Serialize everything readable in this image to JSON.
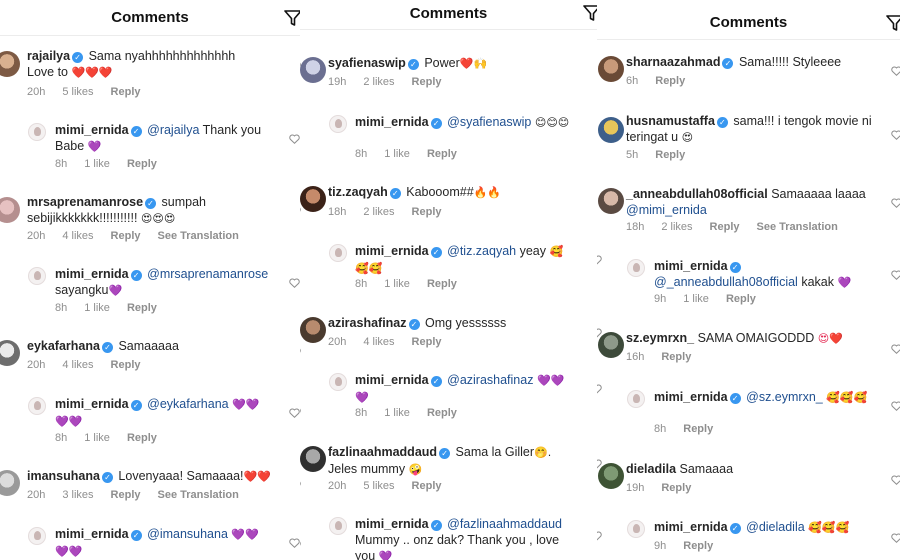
{
  "panels": [
    {
      "title": "Comments",
      "comments": [
        {
          "user": "rajailya",
          "verified": true,
          "text": "Sama nyahhhhhhhhhhhhh",
          "text2": "Love to",
          "emoji": "❤️❤️❤️",
          "time": "20h",
          "likes": "5 likes",
          "reply": "Reply",
          "translate": ""
        },
        {
          "user": "mimi_ernida",
          "verified": true,
          "mention": "@rajailya",
          "text": "Thank you",
          "text2": "Babe",
          "emoji": "💜",
          "time": "8h",
          "likes": "1 like",
          "reply": "Reply",
          "translate": ""
        },
        {
          "user": "mrsaprenamanrose",
          "verified": true,
          "text": "sumpah",
          "text2": "sebijikkkkkkk!!!!!!!!!!!",
          "emoji": "😍😍😍",
          "time": "20h",
          "likes": "4 likes",
          "reply": "Reply",
          "translate": "See Translation"
        },
        {
          "user": "mimi_ernida",
          "verified": true,
          "mention": "@mrsaprenamanrose",
          "text": "",
          "text2": "sayangku",
          "emoji": "💜",
          "time": "8h",
          "likes": "1 like",
          "reply": "Reply",
          "translate": ""
        },
        {
          "user": "eykafarhana",
          "verified": true,
          "text": "Samaaaaa",
          "time": "20h",
          "likes": "4 likes",
          "reply": "Reply",
          "translate": ""
        },
        {
          "user": "mimi_ernida",
          "verified": true,
          "mention": "@eykafarhana",
          "text": "",
          "emoji": "💜💜💜💜",
          "time": "8h",
          "likes": "1 like",
          "reply": "Reply",
          "translate": ""
        },
        {
          "user": "imansuhana",
          "verified": true,
          "text": "Lovenyaaa! Samaaaa!",
          "emoji": "❤️❤️",
          "time": "20h",
          "likes": "3 likes",
          "reply": "Reply",
          "translate": "See Translation"
        },
        {
          "user": "mimi_ernida",
          "verified": true,
          "mention": "@imansuhana",
          "text": "",
          "emoji": "💜💜💜💜"
        }
      ]
    },
    {
      "title": "Comments",
      "comments": [
        {
          "user": "syafienaswip",
          "verified": true,
          "text": "Power",
          "emoji": "❤️🙌",
          "time": "19h",
          "likes": "2 likes",
          "reply": "Reply"
        },
        {
          "user": "mimi_ernida",
          "verified": true,
          "mention": "@syafienaswip",
          "emoji": "😊😊😊",
          "time": "8h",
          "likes": "1 like",
          "reply": "Reply"
        },
        {
          "user": "tiz.zaqyah",
          "verified": true,
          "text": "Kabooom##",
          "emoji": "🔥🔥",
          "time": "18h",
          "likes": "2 likes",
          "reply": "Reply"
        },
        {
          "user": "mimi_ernida",
          "verified": true,
          "mention": "@tiz.zaqyah",
          "text": "yeay",
          "emoji": "🥰🥰🥰",
          "time": "8h",
          "likes": "1 like",
          "reply": "Reply"
        },
        {
          "user": "azirashafinaz",
          "verified": true,
          "text": "Omg yessssss",
          "time": "20h",
          "likes": "4 likes",
          "reply": "Reply"
        },
        {
          "user": "mimi_ernida",
          "verified": true,
          "mention": "@azirashafinaz",
          "emoji": "💜💜💜",
          "time": "8h",
          "likes": "1 like",
          "reply": "Reply"
        },
        {
          "user": "fazlinaahmaddaud",
          "verified": true,
          "text": "Sama la Giller",
          "text2": "Jeles mummy",
          "emoji": "🤭.",
          "emoji2": "🤪",
          "time": "20h",
          "likes": "5 likes",
          "reply": "Reply"
        },
        {
          "user": "mimi_ernida",
          "verified": true,
          "mention": "@fazlinaahmaddaud",
          "text2": "Mummy .. onz dak? Thank you , love",
          "text3": "you",
          "emoji": "💜"
        }
      ]
    },
    {
      "title": "Comments",
      "comments": [
        {
          "user": "sharnaazahmad",
          "verified": true,
          "text": "Sama!!!!! Styleeee",
          "time": "6h",
          "likes": "",
          "reply": "Reply"
        },
        {
          "user": "husnamustaffa",
          "verified": true,
          "text": "sama!!! i tengok movie ni",
          "text2": "teringat u",
          "emoji": "😍",
          "time": "5h",
          "likes": "",
          "reply": "Reply"
        },
        {
          "user": "_anneabdullah08official",
          "verified": false,
          "text": "Samaaaaa laaaa",
          "mention2": "@mimi_ernida",
          "time": "18h",
          "likes": "2 likes",
          "reply": "Reply",
          "translate": "See Translation"
        },
        {
          "user": "mimi_ernida",
          "verified": true,
          "mention": "@_anneabdullah08official",
          "text": "kakak",
          "emoji": "💜",
          "time": "9h",
          "likes": "1 like",
          "reply": "Reply"
        },
        {
          "user": "sz.eymrxn_",
          "verified": false,
          "text": "SAMA OMAIGODDD",
          "emoji": "😍❤️",
          "time": "16h",
          "likes": "",
          "reply": "Reply"
        },
        {
          "user": "mimi_ernida",
          "verified": true,
          "mention": "@sz.eymrxn_",
          "emoji": "🥰🥰🥰",
          "time": "8h",
          "likes": "",
          "reply": "Reply"
        },
        {
          "user": "dieladila",
          "verified": false,
          "text": "Samaaaa",
          "time": "19h",
          "likes": "",
          "reply": "Reply"
        },
        {
          "user": "mimi_ernida",
          "verified": true,
          "mention": "@dieladila",
          "emoji": "🥰🥰🥰",
          "time": "9h",
          "likes": "",
          "reply": "Reply"
        }
      ]
    }
  ],
  "icons": {
    "filter": "filter-icon",
    "heart": "heart-outline-icon",
    "verified": "verified-badge-icon"
  },
  "colors": {
    "heart_red": "#e4254f",
    "heart_purple": "#8a33d8",
    "verified_blue": "#3897f0",
    "mention_blue": "#1f4f8f"
  }
}
